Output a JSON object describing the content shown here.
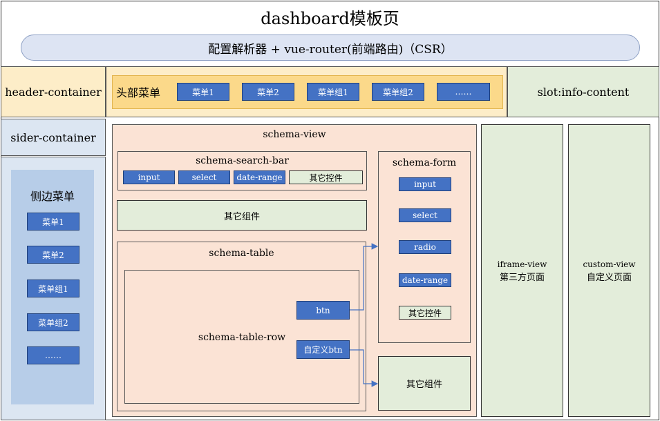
{
  "title": "dashboard模板页",
  "router": "配置解析器 + vue-router(前端路由)（CSR）",
  "header": {
    "container_label": "header-container",
    "menu_label": "头部菜单",
    "items": [
      "菜单1",
      "菜单2",
      "菜单组1",
      "菜单组2",
      "……"
    ]
  },
  "slot_label": "slot:info-content",
  "sider": {
    "container_label": "sider-container",
    "menu_label": "侧边菜单",
    "items": [
      "菜单1",
      "菜单2",
      "菜单组1",
      "菜单组2",
      "……"
    ]
  },
  "schema_view": {
    "label": "schema-view",
    "search_bar": {
      "label": "schema-search-bar",
      "controls": [
        "input",
        "select",
        "date-range",
        "其它控件"
      ]
    },
    "other_component": "其它组件",
    "table": {
      "label": "schema-table",
      "row_label": "schema-table-row",
      "btn": "btn",
      "custom_btn": "自定义btn"
    },
    "form": {
      "label": "schema-form",
      "controls": [
        "input",
        "select",
        "radio",
        "date-range",
        "其它控件"
      ]
    },
    "other_component_2": "其它组件"
  },
  "iframe_view": {
    "line1": "iframe-view",
    "line2": "第三方页面"
  },
  "custom_view": {
    "line1": "custom-view",
    "line2": "自定义页面"
  },
  "colors": {
    "button_blue": "#4472c4",
    "header_yellow": "#fdedc8",
    "sider_blue": "#dce6f2",
    "view_peach": "#fbe3d5",
    "pane_green": "#e3edda",
    "arrow": "#4472c4"
  }
}
